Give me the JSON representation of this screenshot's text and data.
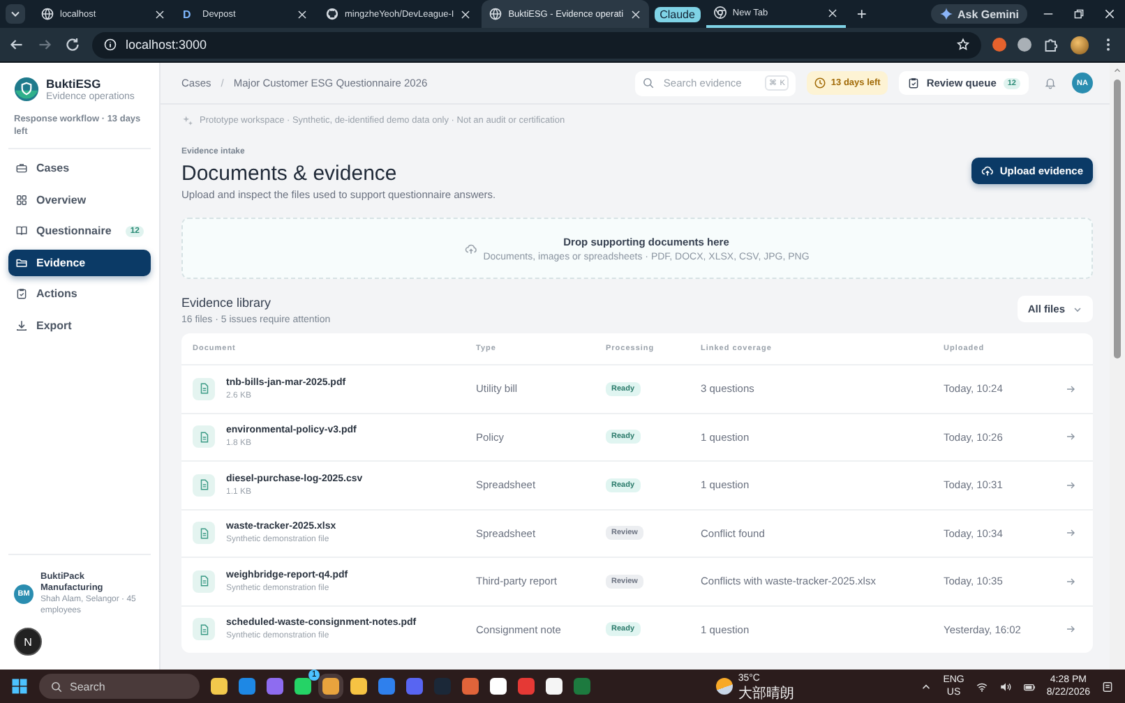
{
  "browser": {
    "tabs": [
      {
        "title": "localhost",
        "selected": false
      },
      {
        "title": "Devpost",
        "letter": "D",
        "selected": false
      },
      {
        "title": "mingzheYeoh/DevLeague-I",
        "selected": false
      },
      {
        "title": "BuktiESG - Evidence operati",
        "selected": true
      },
      {
        "title": "New Tab",
        "selected": false,
        "group": "Claude"
      }
    ],
    "new_tab": "+",
    "gemini": "Ask Gemini",
    "address": "localhost:3000"
  },
  "sidebar": {
    "brand": "BuktiESG",
    "tagline": "Evidence operations",
    "workflow": "Response workflow · 13 days left",
    "items": [
      {
        "label": "Cases",
        "selected": false
      },
      {
        "label": "Overview",
        "selected": false
      },
      {
        "label": "Questionnaire",
        "selected": false,
        "badge": "12"
      },
      {
        "label": "Evidence",
        "selected": true
      },
      {
        "label": "Actions",
        "selected": false
      },
      {
        "label": "Export",
        "selected": false
      }
    ],
    "org": {
      "initials": "BM",
      "name": "BuktiPack Manufacturing",
      "detail": "Shah Alam, Selangor · 45 employees"
    },
    "dev_badge": "N"
  },
  "topbar": {
    "breadcrumb": [
      "Cases",
      "Major Customer ESG Questionnaire 2026"
    ],
    "breadcrumb_separator": "/",
    "search": {
      "placeholder": "Search evidence",
      "shortcut": "⌘ K"
    },
    "deadline": "13 days left",
    "review": {
      "label": "Review queue",
      "count": "12"
    },
    "avatar": "NA"
  },
  "notice": "Prototype workspace · Synthetic, de-identified demo data only · Not an audit or certification",
  "header": {
    "eyebrow": "Evidence intake",
    "title": "Documents & evidence",
    "subtitle": "Upload and inspect the files used to support questionnaire answers.",
    "button": "Upload evidence"
  },
  "dropzone": {
    "title": "Drop supporting documents here",
    "hint": "Documents, images or spreadsheets · PDF, DOCX, XLSX, CSV, JPG, PNG"
  },
  "library": {
    "title": "Evidence library",
    "summary": "16 files · 5 issues require attention",
    "filter": "All files",
    "columns": [
      "Document",
      "Type",
      "Processing",
      "Linked coverage",
      "Uploaded"
    ],
    "rows": [
      {
        "name": "tnb-bills-jan-mar-2025.pdf",
        "meta": "2.6 KB",
        "type": "Utility bill",
        "status": "Ready",
        "kind": "ready",
        "coverage": "3 questions",
        "uploaded": "Today, 10:24"
      },
      {
        "name": "environmental-policy-v3.pdf",
        "meta": "1.8 KB",
        "type": "Policy",
        "status": "Ready",
        "kind": "ready",
        "coverage": "1 question",
        "uploaded": "Today, 10:26"
      },
      {
        "name": "diesel-purchase-log-2025.csv",
        "meta": "1.1 KB",
        "type": "Spreadsheet",
        "status": "Ready",
        "kind": "ready",
        "coverage": "1 question",
        "uploaded": "Today, 10:31"
      },
      {
        "name": "waste-tracker-2025.xlsx",
        "meta": "Synthetic demonstration file",
        "type": "Spreadsheet",
        "status": "Review",
        "kind": "review",
        "coverage": "Conflict found",
        "uploaded": "Today, 10:34"
      },
      {
        "name": "weighbridge-report-q4.pdf",
        "meta": "Synthetic demonstration file",
        "type": "Third-party report",
        "status": "Review",
        "kind": "review",
        "coverage": "Conflicts with waste-tracker-2025.xlsx",
        "uploaded": "Today, 10:35"
      },
      {
        "name": "scheduled-waste-consignment-notes.pdf",
        "meta": "Synthetic demonstration file",
        "type": "Consignment note",
        "status": "Ready",
        "kind": "ready",
        "coverage": "1 question",
        "uploaded": "Yesterday, 16:02"
      }
    ]
  },
  "taskbar": {
    "search": "Search",
    "whatsapp_badge": "1",
    "weather": {
      "temp": "35°C",
      "condition": "大部晴朗"
    },
    "lang": "ENG",
    "region": "US",
    "time": "4:28 PM",
    "date": "8/22/2026"
  }
}
